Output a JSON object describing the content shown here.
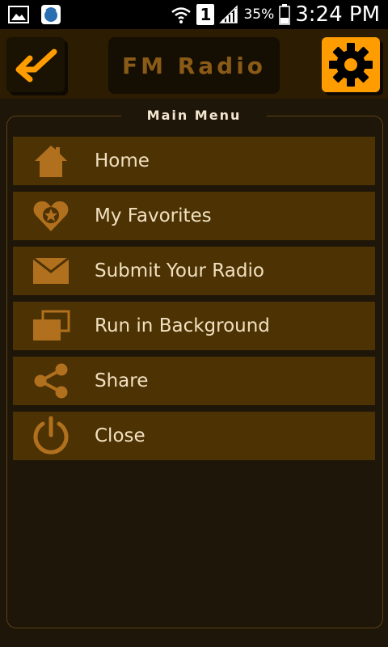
{
  "status_bar": {
    "sim_slot": "1",
    "battery_percent": "35%",
    "time": "3:24 PM"
  },
  "app_bar": {
    "title": "FM Radio",
    "back_icon": "back-arrow-icon",
    "settings_icon": "gear-icon"
  },
  "menu": {
    "header": "Main Menu",
    "items": [
      {
        "label": "Home",
        "icon": "home-icon"
      },
      {
        "label": "My Favorites",
        "icon": "heart-star-icon"
      },
      {
        "label": "Submit Your Radio",
        "icon": "envelope-icon"
      },
      {
        "label": "Run in Background",
        "icon": "windows-icon"
      },
      {
        "label": "Share",
        "icon": "share-icon"
      },
      {
        "label": "Close",
        "icon": "power-icon"
      }
    ]
  },
  "colors": {
    "accent": "#ff9d00",
    "icon": "#b0701e",
    "item_bg": "#4d3204",
    "text": "#f0e0c0",
    "background": "#1e1608"
  }
}
